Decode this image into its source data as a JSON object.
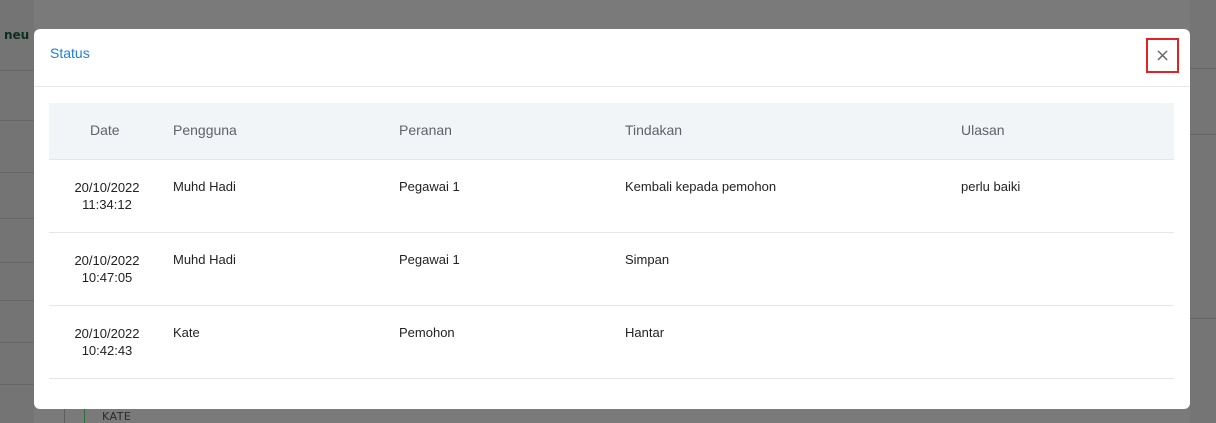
{
  "background": {
    "brand_fragment": "neu",
    "row_text": "KATE"
  },
  "modal": {
    "title": "Status",
    "close_label": "×",
    "table": {
      "headers": [
        "Date",
        "Pengguna",
        "Peranan",
        "Tindakan",
        "Ulasan"
      ],
      "rows": [
        {
          "date": "20/10/2022",
          "time": "11:34:12",
          "pengguna": "Muhd Hadi",
          "peranan": "Pegawai 1",
          "tindakan": "Kembali kepada pemohon",
          "ulasan": "perlu baiki"
        },
        {
          "date": "20/10/2022",
          "time": "10:47:05",
          "pengguna": "Muhd Hadi",
          "peranan": "Pegawai 1",
          "tindakan": "Simpan",
          "ulasan": ""
        },
        {
          "date": "20/10/2022",
          "time": "10:42:43",
          "pengguna": "Kate",
          "peranan": "Pemohon",
          "tindakan": "Hantar",
          "ulasan": ""
        }
      ]
    }
  },
  "colors": {
    "title": "#1f7de0",
    "close_highlight": "#e02424",
    "header_bg": "#f2f5f7"
  }
}
